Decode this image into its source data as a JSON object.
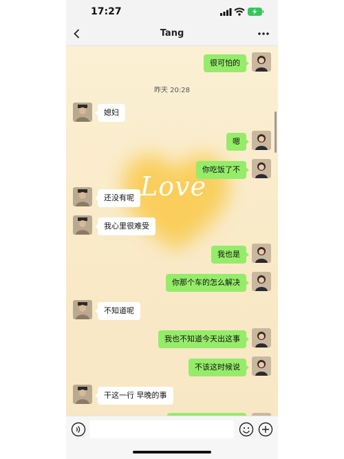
{
  "status_bar": {
    "time": "17:27"
  },
  "header": {
    "title": "Tang",
    "back_icon": "chevron-left-icon",
    "more_icon": "more-dots-icon"
  },
  "background": {
    "decoration_text": "Love",
    "heart_color": "#f9c94a"
  },
  "chat": {
    "timestamp": "昨天 20:28",
    "messages": [
      {
        "from": "me",
        "text": "很可怕的"
      },
      {
        "from": "them",
        "text": "媳妇"
      },
      {
        "from": "me",
        "text": "嗯"
      },
      {
        "from": "me",
        "text": "你吃饭了不"
      },
      {
        "from": "them",
        "text": "还没有呢"
      },
      {
        "from": "them",
        "text": "我心里很难受"
      },
      {
        "from": "me",
        "text": "我也是"
      },
      {
        "from": "me",
        "text": "你那个车的怎么解决"
      },
      {
        "from": "them",
        "text": "不知道呢"
      },
      {
        "from": "me",
        "text": "我也不知道今天出这事"
      },
      {
        "from": "me",
        "text": "不该这时候说"
      },
      {
        "from": "them",
        "text": "干这一行 早晚的事"
      }
    ]
  },
  "input_bar": {
    "voice_icon": "voice-icon",
    "emoji_icon": "emoji-icon",
    "plus_icon": "plus-icon"
  },
  "colors": {
    "my_bubble": "#95ec69",
    "their_bubble": "#ffffff"
  }
}
